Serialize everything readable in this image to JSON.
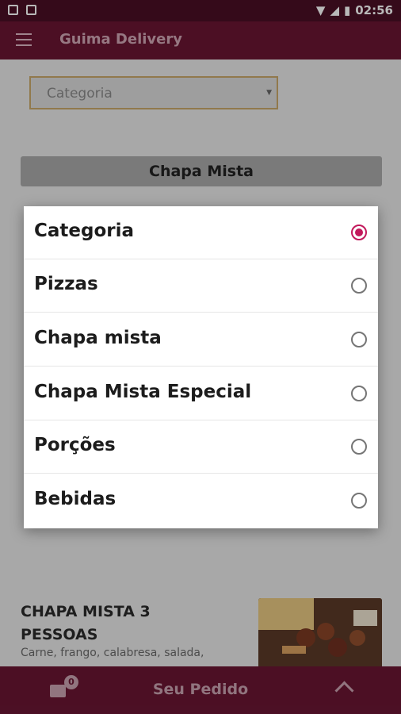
{
  "status_bar": {
    "time": "02:56"
  },
  "app_bar": {
    "title": "Guima Delivery"
  },
  "filter": {
    "selected": "Categoria"
  },
  "category_header": "Chapa Mista",
  "product": {
    "title_line1": "CHAPA MISTA 3",
    "title_line2": "PESSOAS",
    "description": "Carne, frango, calabresa, salada,"
  },
  "dialog": {
    "options": [
      {
        "label": "Categoria",
        "selected": true
      },
      {
        "label": "Pizzas",
        "selected": false
      },
      {
        "label": "Chapa mista",
        "selected": false
      },
      {
        "label": "Chapa Mista Especial",
        "selected": false
      },
      {
        "label": "Porções",
        "selected": false
      },
      {
        "label": "Bebidas",
        "selected": false
      }
    ]
  },
  "bottom_bar": {
    "cart_count": "0",
    "label": "Seu Pedido"
  },
  "colors": {
    "primary": "#6a1633",
    "status_bar": "#4a0f25",
    "radio_accent": "#c2185b"
  }
}
